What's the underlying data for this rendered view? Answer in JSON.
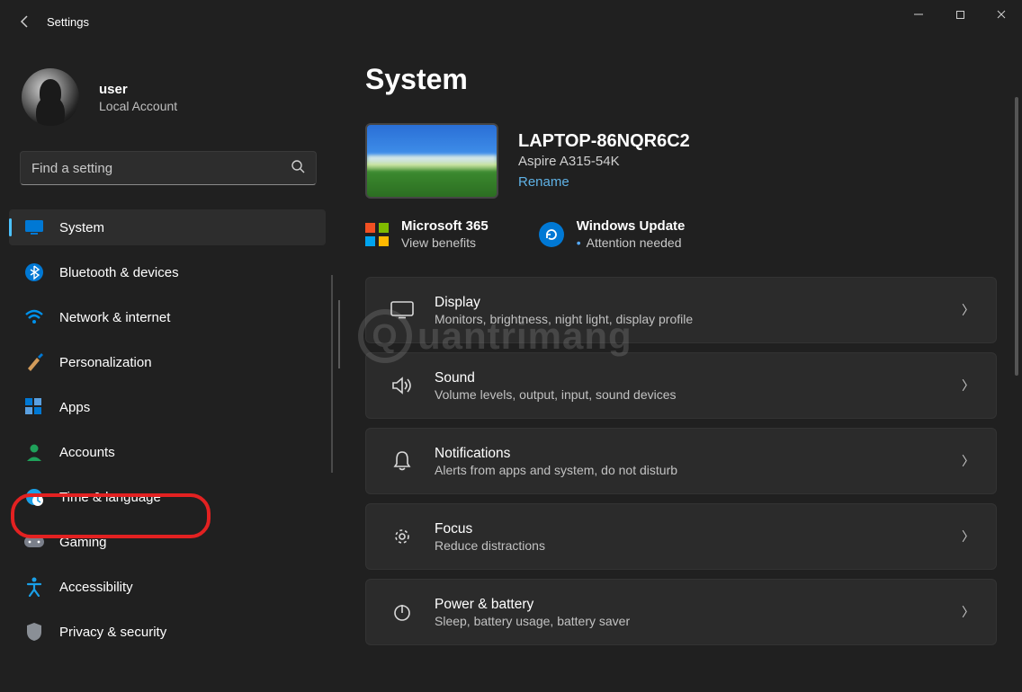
{
  "window": {
    "title": "Settings"
  },
  "user": {
    "name": "user",
    "subtitle": "Local Account"
  },
  "search": {
    "placeholder": "Find a setting"
  },
  "sidebar": {
    "items": [
      {
        "label": "System"
      },
      {
        "label": "Bluetooth & devices"
      },
      {
        "label": "Network & internet"
      },
      {
        "label": "Personalization"
      },
      {
        "label": "Apps"
      },
      {
        "label": "Accounts"
      },
      {
        "label": "Time & language"
      },
      {
        "label": "Gaming"
      },
      {
        "label": "Accessibility"
      },
      {
        "label": "Privacy & security"
      }
    ]
  },
  "page": {
    "title": "System"
  },
  "device": {
    "name": "LAPTOP-86NQR6C2",
    "model": "Aspire A315-54K",
    "rename": "Rename"
  },
  "info": {
    "ms365": {
      "title": "Microsoft 365",
      "sub": "View benefits"
    },
    "wu": {
      "title": "Windows Update",
      "sub": "Attention needed"
    }
  },
  "cards": [
    {
      "title": "Display",
      "sub": "Monitors, brightness, night light, display profile"
    },
    {
      "title": "Sound",
      "sub": "Volume levels, output, input, sound devices"
    },
    {
      "title": "Notifications",
      "sub": "Alerts from apps and system, do not disturb"
    },
    {
      "title": "Focus",
      "sub": "Reduce distractions"
    },
    {
      "title": "Power & battery",
      "sub": "Sleep, battery usage, battery saver"
    }
  ],
  "watermark": "uantrimang"
}
